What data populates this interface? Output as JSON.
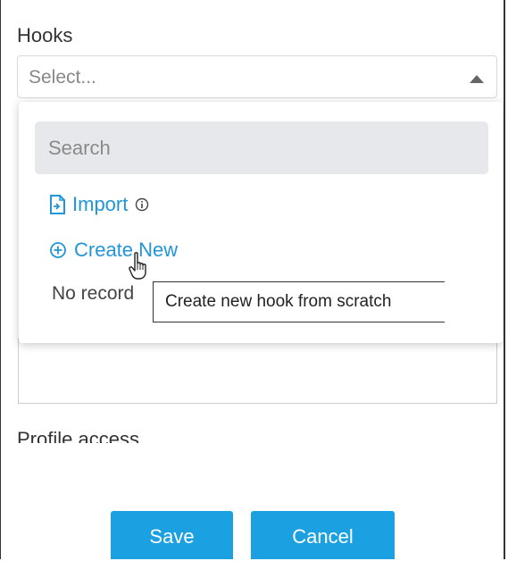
{
  "hooks": {
    "label": "Hooks",
    "select_placeholder": "Select..."
  },
  "dropdown": {
    "search_placeholder": "Search",
    "import_label": "Import",
    "create_new_label": "Create New",
    "empty_text": "No record"
  },
  "tooltip": {
    "text": "Create new hook from scratch"
  },
  "profile_access": {
    "label": "Profile access"
  },
  "buttons": {
    "save": "Save",
    "cancel": "Cancel"
  },
  "colors": {
    "accent": "#1ba1e2",
    "link": "#2196d8"
  },
  "icons": [
    "triangle-up-icon",
    "file-import-icon",
    "info-icon",
    "plus-circle-icon",
    "hand-pointer-icon"
  ]
}
